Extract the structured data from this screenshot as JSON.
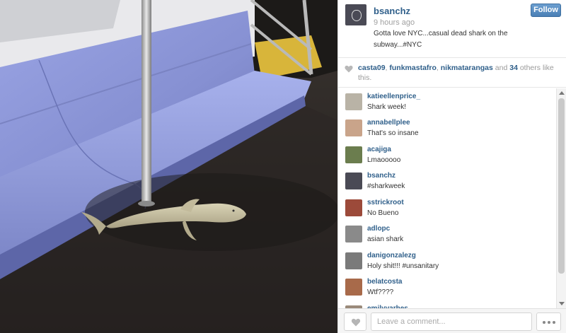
{
  "post": {
    "username": "bsanchz",
    "time": "9 hours ago",
    "caption": "Gotta love NYC...casual dead shark on the subway...#NYC",
    "follow_label": "Follow"
  },
  "likes": {
    "users": [
      "casta09",
      "funkmastafro",
      "nikmatarangas"
    ],
    "separator": ", ",
    "and_text": " and ",
    "others_count": "34",
    "others_text": " others like this."
  },
  "comments": [
    {
      "user": "katieellenprice_",
      "text": "Shark week!",
      "avatar_color": "#b9b3a6"
    },
    {
      "user": "annabellplee",
      "text": "That's so insane",
      "avatar_color": "#c9a48a"
    },
    {
      "user": "acajiga",
      "text": "Lmaooooo",
      "avatar_color": "#6b7d4e"
    },
    {
      "user": "bsanchz",
      "text": "#sharkweek",
      "avatar_color": "#4a4a55"
    },
    {
      "user": "sstrickroot",
      "text": "No Bueno",
      "avatar_color": "#9c4a3a"
    },
    {
      "user": "adlopc",
      "text": "asian shark",
      "avatar_color": "#8a8a8a"
    },
    {
      "user": "danigonzalezg",
      "text": "Holy shit!!! #unsanitary",
      "avatar_color": "#7a7a7a"
    },
    {
      "user": "belatcosta",
      "text": "Wtf????",
      "avatar_color": "#a86a4a"
    },
    {
      "user": "emilyvarhes",
      "text": "",
      "avatar_color": "#9a8a7a"
    }
  ],
  "footer": {
    "comment_placeholder": "Leave a comment..."
  },
  "colors": {
    "link": "#2f5f8a",
    "follow_button": "#4a7fb5",
    "seat": "#8a95d6",
    "floor": "#2a2624"
  },
  "icons": {
    "like": "heart-icon",
    "more": "ellipsis-icon"
  }
}
